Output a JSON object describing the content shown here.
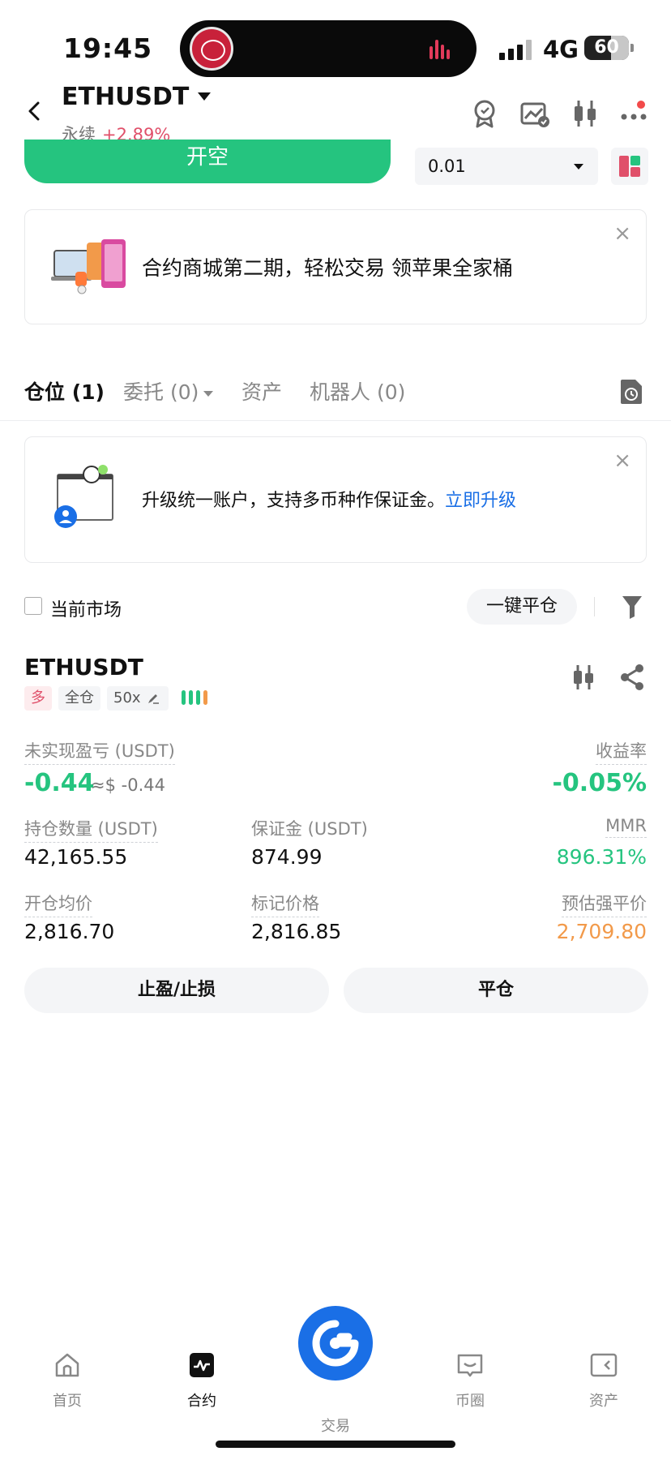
{
  "status_bar": {
    "time": "19:45",
    "network": "4G",
    "battery": "60",
    "battery_level_percent": 60
  },
  "header": {
    "symbol": "ETHUSDT",
    "subtitle": "永续",
    "change": "+2.89%",
    "icons": [
      "back-icon",
      "award-icon",
      "chart-check-icon",
      "candlestick-icon",
      "more-icon"
    ]
  },
  "order": {
    "action_button": "开空",
    "quantity": "0.01"
  },
  "promo_banner": {
    "text": "合约商城第二期，轻松交易 领苹果全家桶",
    "close": "×"
  },
  "tabs": [
    {
      "label": "仓位 (1)",
      "active": true
    },
    {
      "label": "委托 (0)",
      "active": false
    },
    {
      "label": "资产",
      "active": false
    },
    {
      "label": "机器人 (0)",
      "active": false
    }
  ],
  "upgrade_banner": {
    "text": "升级统一账户，支持多币种作保证金。",
    "link": "立即升级",
    "close": "×"
  },
  "filters": {
    "current_market": "当前市场",
    "close_all": "一键平仓"
  },
  "position": {
    "symbol": "ETHUSDT",
    "side": "多",
    "margin_mode": "全仓",
    "leverage": "50x",
    "unrealized_pnl_label": "未实现盈亏 (USDT)",
    "unrealized_pnl": "-0.44",
    "unrealized_pnl_usd": "≈$ -0.44",
    "roe_label": "收益率",
    "roe": "-0.05%",
    "size_label": "持仓数量 (USDT)",
    "size": "42,165.55",
    "margin_label": "保证金 (USDT)",
    "margin": "874.99",
    "mmr_label": "MMR",
    "mmr": "896.31%",
    "entry_price_label": "开仓均价",
    "entry_price": "2,816.70",
    "mark_price_label": "标记价格",
    "mark_price": "2,816.85",
    "liq_price_label": "预估强平价",
    "liq_price": "2,709.80",
    "tpsl_button": "止盈/止损",
    "close_button": "平仓"
  },
  "colors": {
    "green": "#25c47f",
    "red": "#e0506a",
    "orange": "#f29a4a",
    "blue": "#1a6fe6"
  },
  "bottom_nav": [
    {
      "label": "首页",
      "icon": "home-icon",
      "active": false
    },
    {
      "label": "合约",
      "icon": "futures-icon",
      "active": true
    },
    {
      "label": "交易",
      "icon": "trade-icon",
      "active": false
    },
    {
      "label": "币圈",
      "icon": "community-icon",
      "active": false
    },
    {
      "label": "资产",
      "icon": "wallet-icon",
      "active": false
    }
  ]
}
